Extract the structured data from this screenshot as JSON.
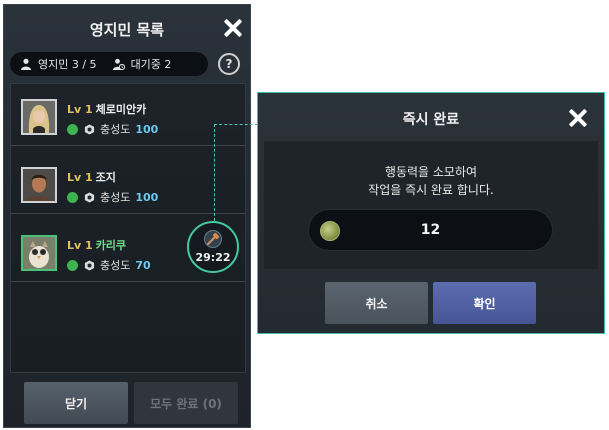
{
  "settlers_panel": {
    "title": "영지민 목록",
    "status": {
      "settlers_label": "영지민 3 / 5",
      "waiting_label": "대기중 2"
    },
    "help_label": "?",
    "settlers": [
      {
        "level": "Lv 1",
        "name": "체로미안카",
        "loyalty_label": "충성도",
        "loyalty": "100",
        "avatar_icon": "blonde-woman-avatar"
      },
      {
        "level": "Lv 1",
        "name": "조지",
        "loyalty_label": "충성도",
        "loyalty": "100",
        "avatar_icon": "man-avatar"
      },
      {
        "level": "Lv 1",
        "name": "카리쿠",
        "loyalty_label": "충성도",
        "loyalty": "70",
        "avatar_icon": "owl-creature-avatar"
      }
    ],
    "timer": "29:22",
    "buttons": {
      "close": "닫기",
      "complete_all": "모두 완료 (0)"
    }
  },
  "instant_dialog": {
    "title": "즉시 완료",
    "message_line1": "행동력을 소모하여",
    "message_line2": "작업을 즉시 완료 합니다.",
    "cost": "12",
    "buttons": {
      "cancel": "취소",
      "confirm": "확인"
    }
  },
  "colors": {
    "panel_bg": "#232a31",
    "accent_teal": "#42c8a6",
    "level_gold": "#e2c25a",
    "loyalty_blue": "#6fc8ef",
    "confirm_blue": "#5566a8"
  }
}
